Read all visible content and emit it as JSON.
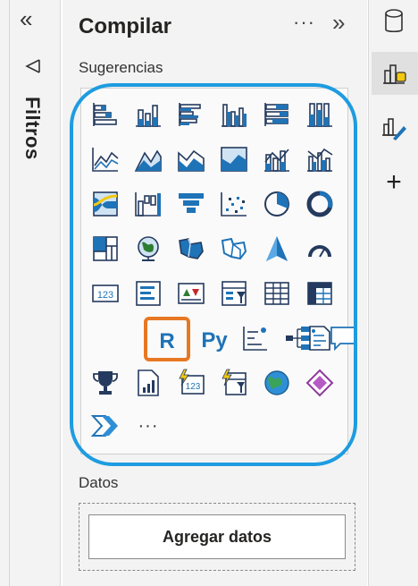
{
  "filters": {
    "label": "Filtros",
    "collapse_icon": "«"
  },
  "build": {
    "title": "Compilar",
    "more_icon": "···",
    "collapse_icon": "»",
    "suggestions_label": "Sugerencias",
    "more_visuals": "···",
    "data_label": "Datos",
    "add_data_label": "Agregar datos"
  },
  "rail": {
    "add_icon": "+"
  },
  "colors": {
    "highlight_blue": "#1e9ce0",
    "highlight_orange": "#e87722",
    "icon_blue": "#1f73b7",
    "icon_navy": "#243a5e",
    "icon_yellow": "#f2c811"
  }
}
